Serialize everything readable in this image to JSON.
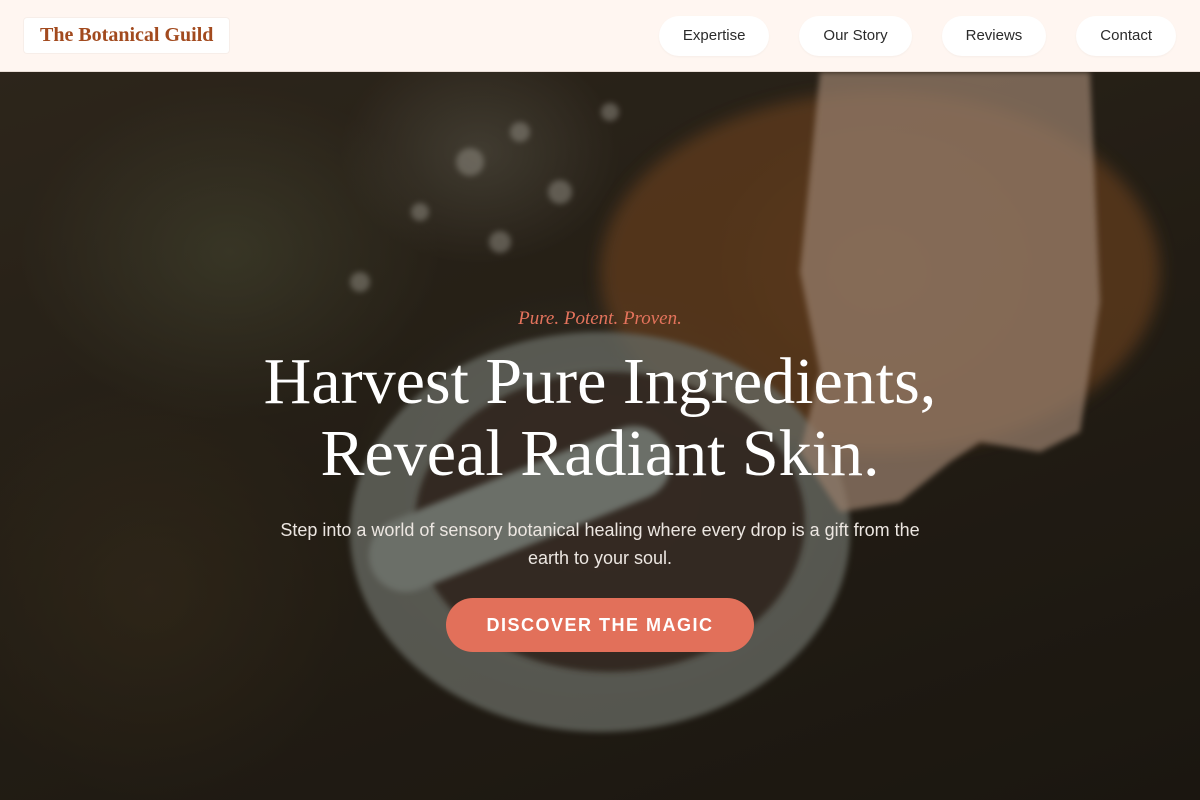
{
  "header": {
    "brand": "The Botanical Guild",
    "nav": [
      {
        "label": "Expertise"
      },
      {
        "label": "Our Story"
      },
      {
        "label": "Reviews"
      },
      {
        "label": "Contact"
      }
    ]
  },
  "hero": {
    "tagline": "Pure. Potent. Proven.",
    "headline_line1": "Harvest Pure Ingredients,",
    "headline_line2": "Reveal Radiant Skin.",
    "subtext": "Step into a world of sensory botanical healing where every drop is a gift from the earth to your soul.",
    "cta_label": "DISCOVER THE MAGIC"
  },
  "colors": {
    "header_bg": "#fff6f1",
    "brand_text": "#a24a1e",
    "accent": "#e2705a",
    "tagline": "#e4735c"
  }
}
